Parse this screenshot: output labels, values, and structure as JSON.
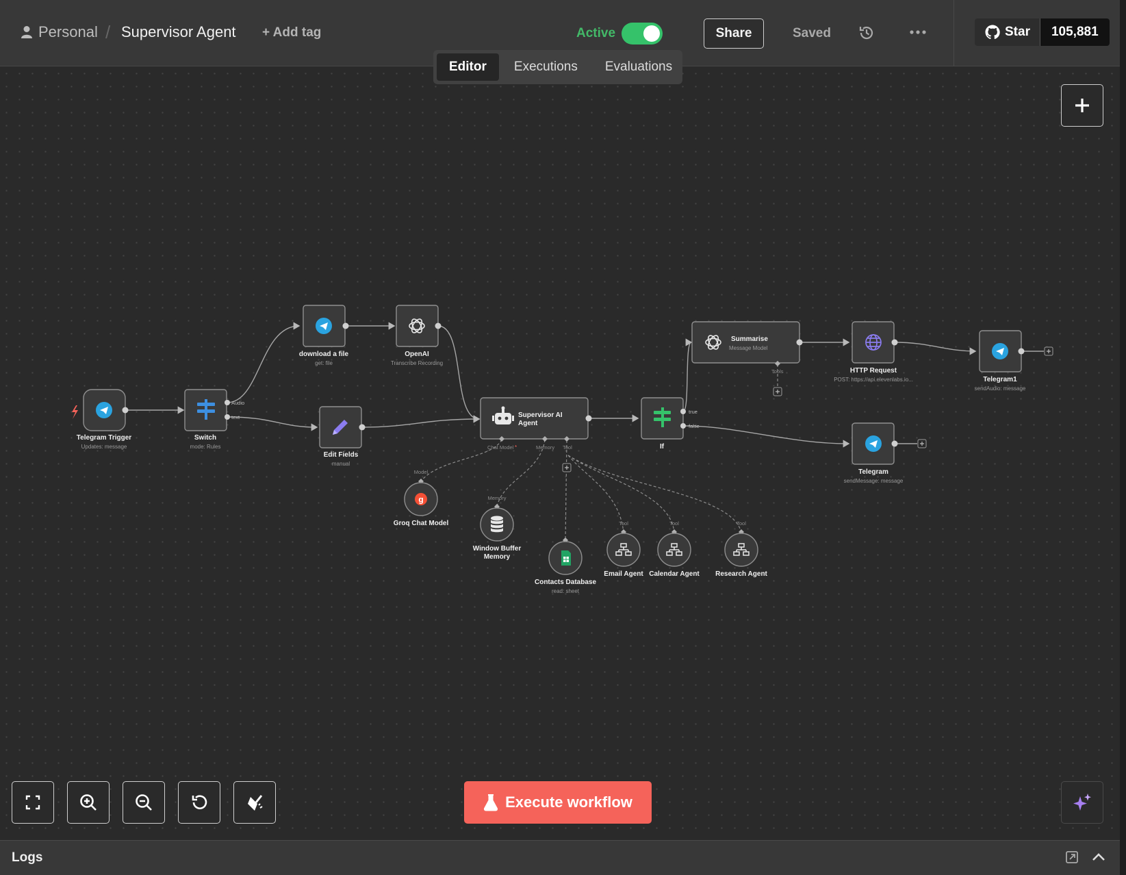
{
  "header": {
    "project": "Personal",
    "separator": "/",
    "workflow_title": "Supervisor Agent",
    "add_tag": "+ Add tag",
    "active_label": "Active",
    "active": true,
    "share": "Share",
    "saved": "Saved",
    "github_star": "Star",
    "github_count": "105,881"
  },
  "tabs": [
    {
      "label": "Editor",
      "active": true
    },
    {
      "label": "Executions",
      "active": false
    },
    {
      "label": "Evaluations",
      "active": false
    }
  ],
  "nodes": {
    "telegram_trigger": {
      "label": "Telegram Trigger",
      "sub": "Updates: message",
      "icon": "telegram-icon"
    },
    "switch": {
      "label": "Switch",
      "sub": "mode: Rules",
      "icon": "switch-icon",
      "outputs": [
        "Audio",
        "text"
      ]
    },
    "download_file": {
      "label": "download a file",
      "sub": "get: file",
      "icon": "telegram-icon"
    },
    "openai": {
      "label": "OpenAI",
      "sub": "Transcribe Recording",
      "icon": "openai-icon"
    },
    "edit_fields": {
      "label": "Edit Fields",
      "sub": "manual",
      "icon": "pencil-icon"
    },
    "supervisor": {
      "label1": "Supervisor AI",
      "label2": "Agent",
      "icon": "robot-icon",
      "ports": [
        "Chat Model",
        "*",
        "Memory",
        "Tool"
      ]
    },
    "if": {
      "label": "If",
      "icon": "if-icon",
      "outputs": [
        "true",
        "false"
      ]
    },
    "summarise": {
      "label": "Summarise",
      "sub": "Message Model",
      "icon": "openai-icon",
      "port": "Tools"
    },
    "http_request": {
      "label": "HTTP Request",
      "sub": "POST: https://api.elevenlabs.io...",
      "icon": "globe-icon"
    },
    "telegram1": {
      "label": "Telegram1",
      "sub": "sendAudio: message",
      "icon": "telegram-icon"
    },
    "telegram": {
      "label": "Telegram",
      "sub": "sendMessage: message",
      "icon": "telegram-icon"
    },
    "groq": {
      "label": "Groq Chat Model",
      "port": "Model",
      "icon": "groq-icon"
    },
    "memory": {
      "label1": "Window Buffer",
      "label2": "Memory",
      "port": "Memory",
      "icon": "database-icon"
    },
    "contacts": {
      "label": "Contacts Database",
      "sub": "read: sheet",
      "icon": "sheets-icon"
    },
    "email_agent": {
      "label": "Email Agent",
      "port": "Tool",
      "icon": "workflow-icon"
    },
    "calendar_agent": {
      "label": "Calendar Agent",
      "port": "Tool",
      "icon": "workflow-icon"
    },
    "research_agent": {
      "label": "Research Agent",
      "port": "Tool",
      "icon": "workflow-icon"
    }
  },
  "toolbar": {
    "execute": "Execute workflow",
    "icons": [
      "fit-view-icon",
      "zoom-in-icon",
      "zoom-out-icon",
      "reset-icon",
      "tidy-icon"
    ]
  },
  "logs": {
    "label": "Logs"
  },
  "colors": {
    "accent": "#f5635a",
    "active_green": "#35c26a",
    "telegram": "#2aa3e0",
    "node_bg": "#3a3a3a"
  }
}
